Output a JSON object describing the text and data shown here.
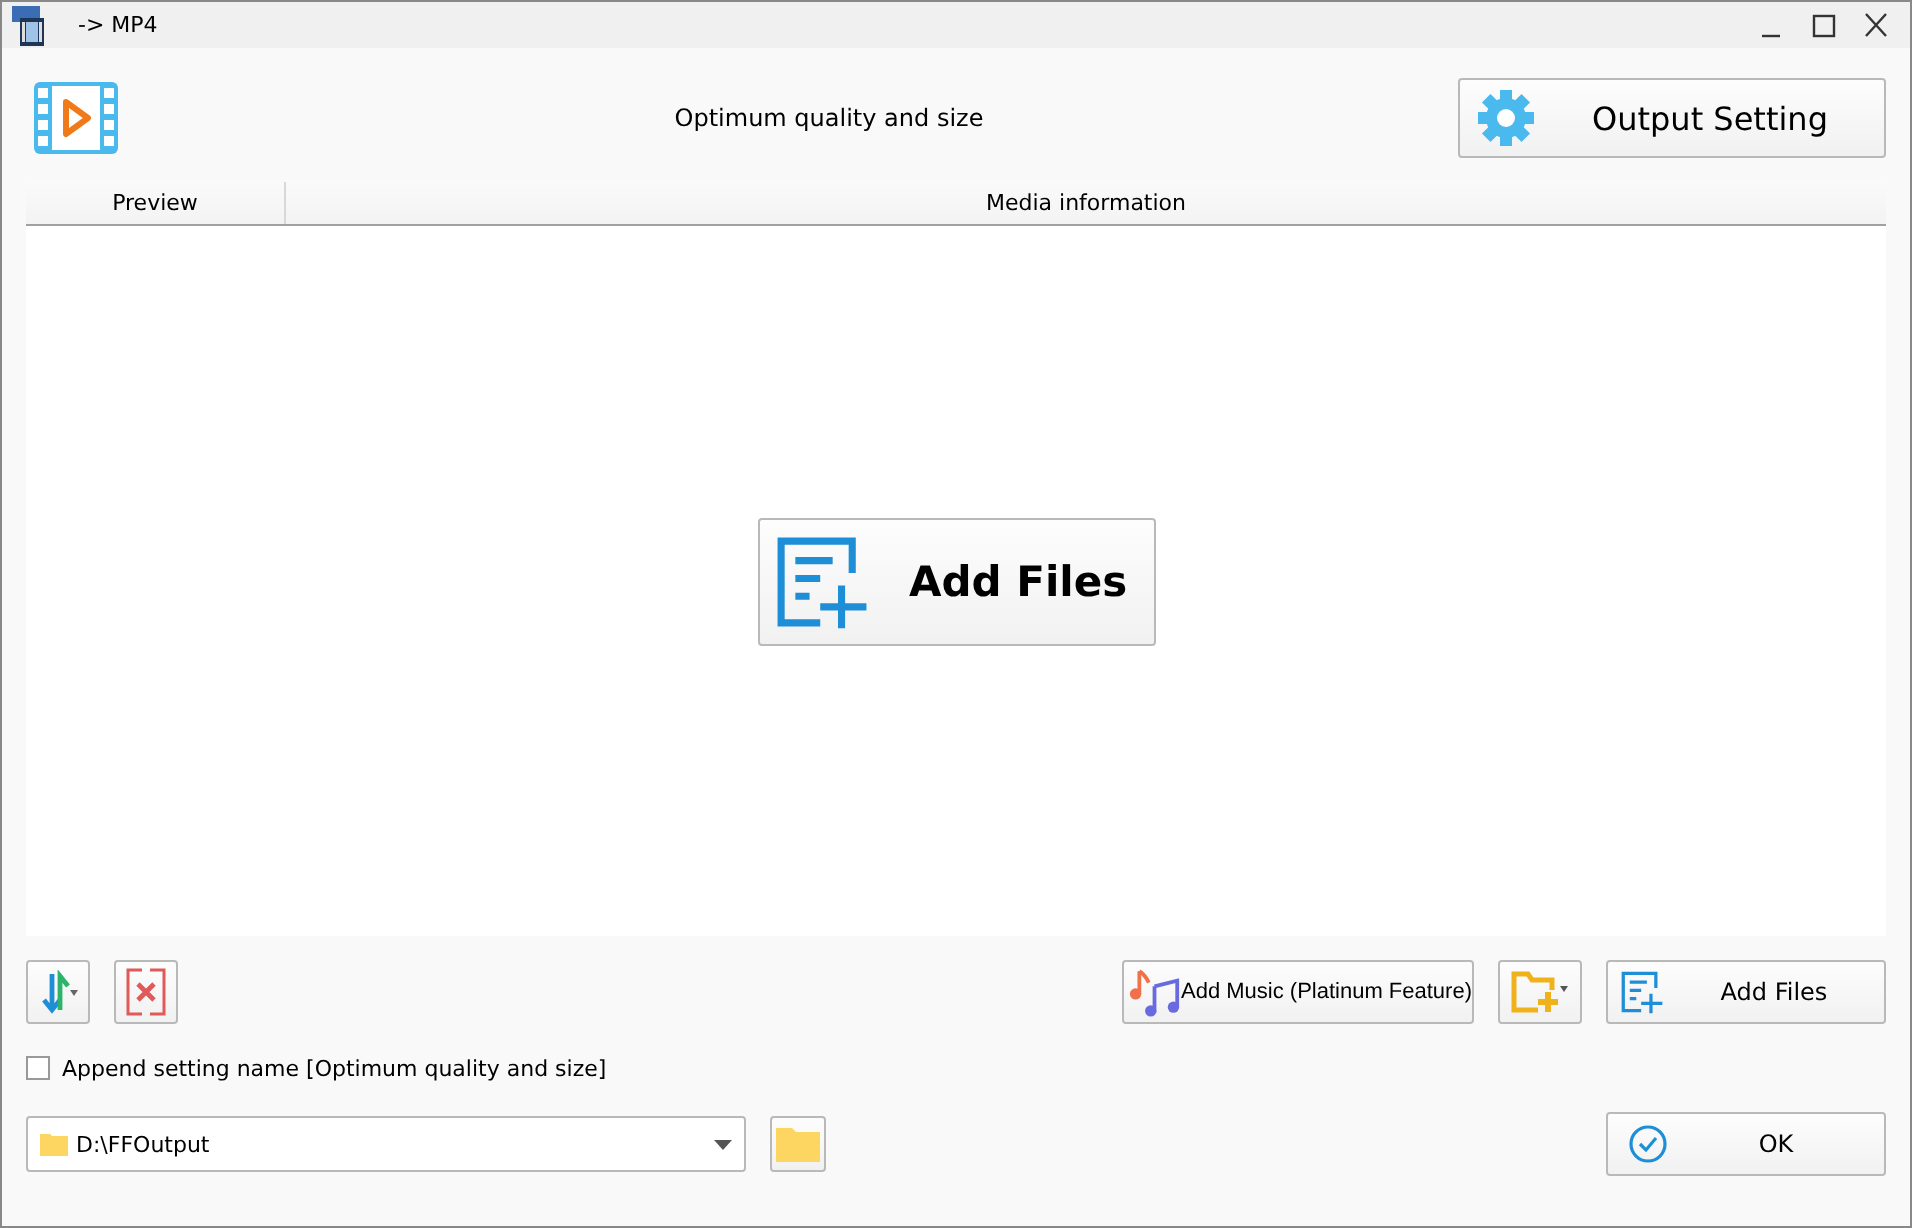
{
  "window": {
    "title": "-> MP4"
  },
  "header": {
    "profile": "Optimum quality and size",
    "output_setting_button": "Output Setting"
  },
  "table": {
    "columns": [
      "Preview",
      "Media information"
    ]
  },
  "drop_area": {
    "add_files_button": "Add Files"
  },
  "toolbar": {
    "add_music_button": "Add Music (Platinum Feature)",
    "add_files_button": "Add Files"
  },
  "append_setting": {
    "label": "Append setting name [Optimum quality and size]",
    "checked": false
  },
  "output_folder": {
    "value": "D:\\FFOutput"
  },
  "ok_button": "OK"
}
